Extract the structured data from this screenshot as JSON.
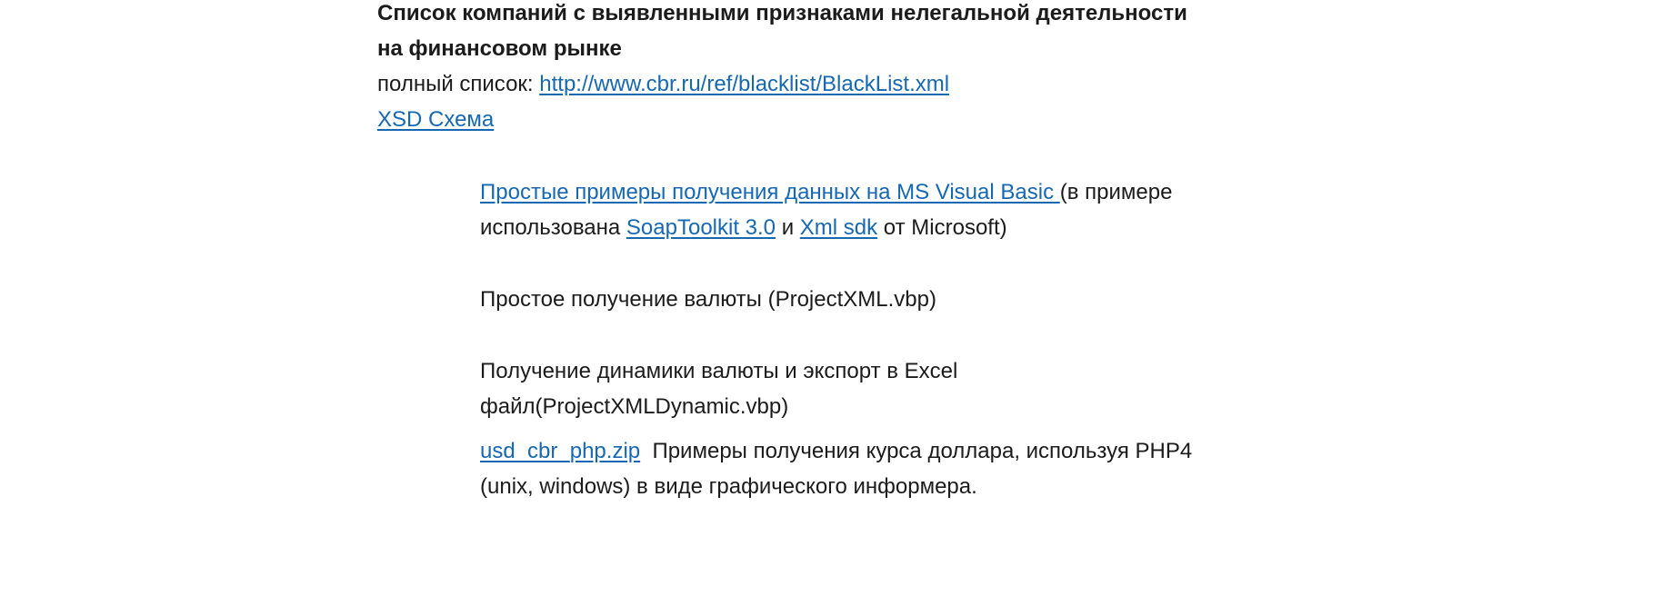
{
  "header": {
    "title_line1": "Список компаний с выявленными признаками нелегальной деятельности",
    "title_line2": "на финансовом рынке",
    "fulllist_label": "полный список: ",
    "fulllist_link": "http://www.cbr.ru/ref/blacklist/BlackList.xml",
    "xsd_link": "XSD Схема"
  },
  "items": {
    "vb": {
      "link": "Простые примеры получения данных на MS Visual Basic ",
      "text1": "(в примере",
      "text2": "использована ",
      "soap_link": "SoapToolkit 3.0",
      "and": " и ",
      "xml_link": "Xml sdk",
      "text3": " от Microsoft)"
    },
    "simple": "Простое получение валюты (ProjectXML.vbp)",
    "dynamic_line1": "Получение динамики валюты и экспорт в Excel",
    "dynamic_line2": "файл(ProjectXMLDynamic.vbp)",
    "php": {
      "link": "usd_cbr_php.zip",
      "text1": "  Примеры получения курса доллара, используя PHP4",
      "text2": "(unix, windows) в виде графического информера."
    }
  }
}
